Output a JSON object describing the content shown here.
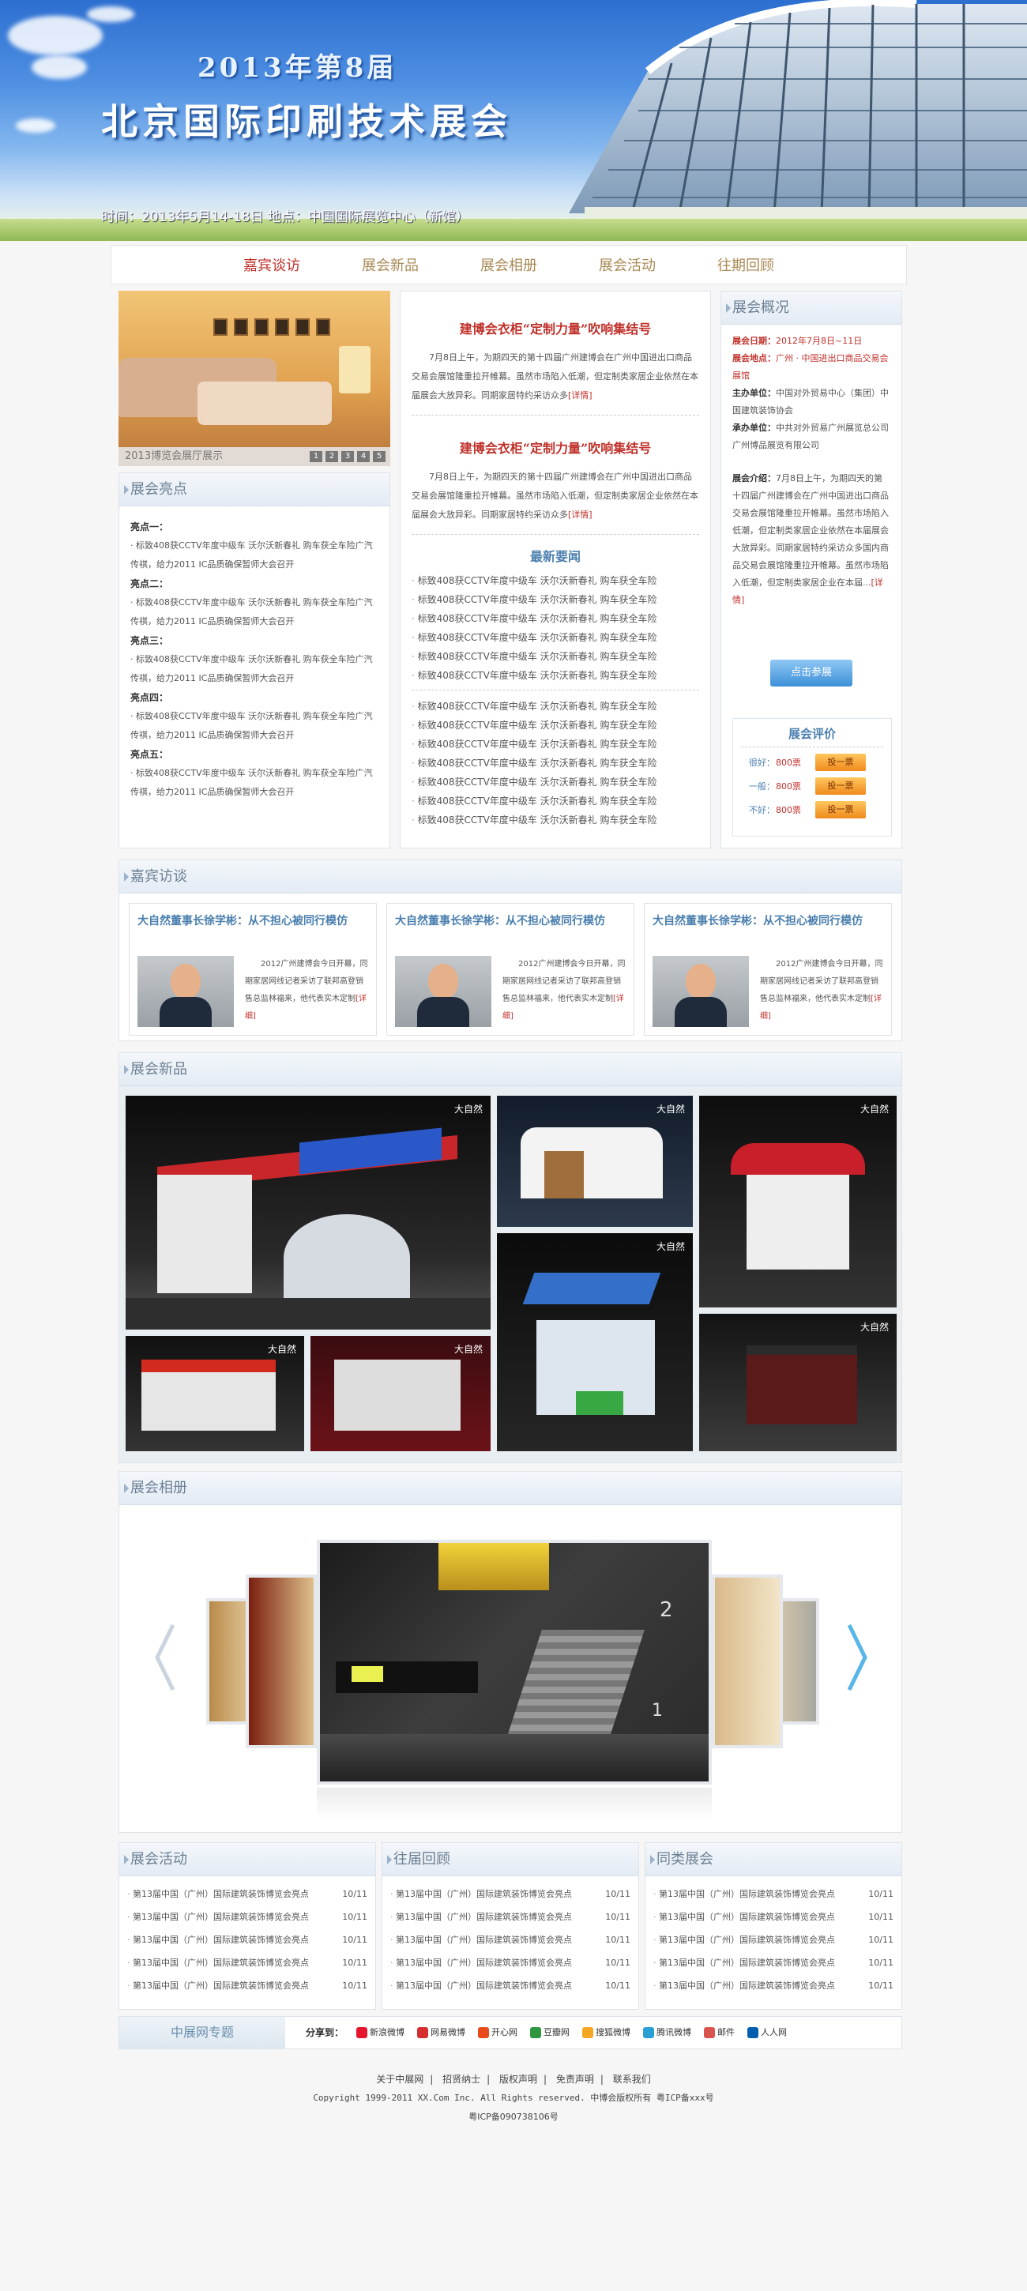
{
  "banner": {
    "subtitle": "2013年第8届",
    "title": "北京国际印刷技术展会",
    "info": "时间：2013年5月14-18日  地点：中国国际展览中心（新馆）"
  },
  "nav": [
    "嘉宾谈访",
    "展会新品",
    "展会相册",
    "展会活动",
    "往期回顾"
  ],
  "slider": {
    "caption": "2013博览会展厅展示",
    "pages": [
      "1",
      "2",
      "3",
      "4",
      "5"
    ]
  },
  "highlights": {
    "title": "展会亮点",
    "items": [
      {
        "label": "亮点一：",
        "text": "· 标致408获CCTV年度中级车 沃尔沃新春礼 购车获全车险广汽传祺，给力2011 IC品质确保暂师大会召开"
      },
      {
        "label": "亮点二：",
        "text": "· 标致408获CCTV年度中级车 沃尔沃新春礼 购车获全车险广汽传祺，给力2011 IC品质确保暂师大会召开"
      },
      {
        "label": "亮点三：",
        "text": "· 标致408获CCTV年度中级车 沃尔沃新春礼 购车获全车险广汽传祺，给力2011 IC品质确保暂师大会召开"
      },
      {
        "label": "亮点四：",
        "text": "· 标致408获CCTV年度中级车 沃尔沃新春礼 购车获全车险广汽传祺，给力2011 IC品质确保暂师大会召开"
      },
      {
        "label": "亮点五：",
        "text": "· 标致408获CCTV年度中级车 沃尔沃新春礼 购车获全车险广汽传祺，给力2011 IC品质确保暂师大会召开"
      }
    ]
  },
  "news": {
    "headline1": "建博会衣柜“定制力量”吹响集结号",
    "para1": "7月8日上午，为期四天的第十四届广州建博会在广州中国进出口商品交易会展馆隆重拉开帷幕。虽然市场陷入低潮，但定制类家居企业依然在本届展会大放异彩。同期家居特约采访众多",
    "more": "[详情]",
    "headline2": "建博会衣柜“定制力量”吹响集结号",
    "para2": "7月8日上午，为期四天的第十四届广州建博会在广州中国进出口商品交易会展馆隆重拉开帷幕。虽然市场陷入低潮，但定制类家居企业依然在本届展会大放异彩。同期家居特约采访众多",
    "latest_title": "最新要闻",
    "list1": [
      "标致408获CCTV年度中级车 沃尔沃新春礼 购车获全车险",
      "标致408获CCTV年度中级车 沃尔沃新春礼 购车获全车险",
      "标致408获CCTV年度中级车 沃尔沃新春礼 购车获全车险",
      "标致408获CCTV年度中级车 沃尔沃新春礼 购车获全车险",
      "标致408获CCTV年度中级车 沃尔沃新春礼 购车获全车险",
      "标致408获CCTV年度中级车 沃尔沃新春礼 购车获全车险"
    ],
    "list2": [
      "标致408获CCTV年度中级车 沃尔沃新春礼 购车获全车险",
      "标致408获CCTV年度中级车 沃尔沃新春礼 购车获全车险",
      "标致408获CCTV年度中级车 沃尔沃新春礼 购车获全车险",
      "标致408获CCTV年度中级车 沃尔沃新春礼 购车获全车险",
      "标致408获CCTV年度中级车 沃尔沃新春礼 购车获全车险",
      "标致408获CCTV年度中级车 沃尔沃新春礼 购车获全车险",
      "标致408获CCTV年度中级车 沃尔沃新春礼 购车获全车险"
    ]
  },
  "overview": {
    "title": "展会概况",
    "date_label": "展会日期：",
    "date": "2012年7月8日~11日",
    "venue_label": "展会地点：",
    "venue": "广州 · 中国进出口商品交易会展馆",
    "host_label": "主办单位：",
    "host": "中国对外贸易中心（集团）中国建筑装饰协会",
    "organizer_label": "承办单位：",
    "organizer": "中共对外贸易广州展览总公司广州博品展览有限公司",
    "intro_label": "展会介绍：",
    "intro": "7月8日上午，为期四天的第十四届广州建博会在广州中国进出口商品交易会展馆隆重拉开帷幕。虽然市场陷入低潮，但定制类家居企业依然在本届展会大放异彩。同期家居特约采访众多国内商品交易会展馆隆重拉开帷幕。虽然市场陷入低潮，但定制类家居企业在本届...",
    "more": "[详情]",
    "visit_button": "点击参展",
    "rating": {
      "title": "展会评价",
      "rows": [
        {
          "label": "很好：",
          "count": "800票",
          "button": "投一票"
        },
        {
          "label": "一般：",
          "count": "800票",
          "button": "投一票"
        },
        {
          "label": "不好：",
          "count": "800票",
          "button": "投一票"
        }
      ]
    }
  },
  "guests": {
    "title": "嘉宾访谈",
    "cards": [
      {
        "heading": "大自然董事长徐学彬：从不担心被同行模仿",
        "text": "2012广州建博会今日开幕，同期家居网线记者采访了联邦高登销售总监林福来，他代表实木定制",
        "more": "[详细]"
      },
      {
        "heading": "大自然董事长徐学彬：从不担心被同行模仿",
        "text": "2012广州建博会今日开幕，同期家居网线记者采访了联邦高登销售总监林福来，他代表实木定制",
        "more": "[详细]"
      },
      {
        "heading": "大自然董事长徐学彬：从不担心被同行模仿",
        "text": "2012广州建博会今日开幕，同期家居网线记者采访了联邦高登销售总监林福来，他代表实木定制",
        "more": "[详细]"
      }
    ]
  },
  "products": {
    "title": "展会新品",
    "tag": "大自然"
  },
  "gallery": {
    "title": "展会相册"
  },
  "activities": {
    "title": "展会活动",
    "items": [
      {
        "text": "第13届中国（广州）国际建筑装饰博览会亮点",
        "date": "10/11"
      },
      {
        "text": "第13届中国（广州）国际建筑装饰博览会亮点",
        "date": "10/11"
      },
      {
        "text": "第13届中国（广州）国际建筑装饰博览会亮点",
        "date": "10/11"
      },
      {
        "text": "第13届中国（广州）国际建筑装饰博览会亮点",
        "date": "10/11"
      },
      {
        "text": "第13届中国（广州）国际建筑装饰博览会亮点",
        "date": "10/11"
      }
    ]
  },
  "review": {
    "title": "往届回顾",
    "items": [
      {
        "text": "第13届中国（广州）国际建筑装饰博览会亮点",
        "date": "10/11"
      },
      {
        "text": "第13届中国（广州）国际建筑装饰博览会亮点",
        "date": "10/11"
      },
      {
        "text": "第13届中国（广州）国际建筑装饰博览会亮点",
        "date": "10/11"
      },
      {
        "text": "第13届中国（广州）国际建筑装饰博览会亮点",
        "date": "10/11"
      },
      {
        "text": "第13届中国（广州）国际建筑装饰博览会亮点",
        "date": "10/11"
      }
    ]
  },
  "similar": {
    "title": "同类展会",
    "items": [
      {
        "text": "第13届中国（广州）国际建筑装饰博览会亮点",
        "date": "10/11"
      },
      {
        "text": "第13届中国（广州）国际建筑装饰博览会亮点",
        "date": "10/11"
      },
      {
        "text": "第13届中国（广州）国际建筑装饰博览会亮点",
        "date": "10/11"
      },
      {
        "text": "第13届中国（广州）国际建筑装饰博览会亮点",
        "date": "10/11"
      },
      {
        "text": "第13届中国（广州）国际建筑装饰博览会亮点",
        "date": "10/11"
      }
    ]
  },
  "share": {
    "tag": "中展网专题",
    "label": "分享到：",
    "items": [
      {
        "name": "新浪微博",
        "color": "#e6162d"
      },
      {
        "name": "网易微博",
        "color": "#d42e2e"
      },
      {
        "name": "开心网",
        "color": "#e94a1b"
      },
      {
        "name": "豆瓣网",
        "color": "#2e963d"
      },
      {
        "name": "搜狐微博",
        "color": "#f5a623"
      },
      {
        "name": "腾讯微博",
        "color": "#2a9fd6"
      },
      {
        "name": "邮件",
        "color": "#d9534f"
      },
      {
        "name": "人人网",
        "color": "#005eac"
      }
    ]
  },
  "footer": {
    "links": [
      "关于中展网",
      "招贤纳士",
      "版权声明",
      "免责声明",
      "联系我们"
    ],
    "copyright": "Copyright 1999-2011 XX.Com Inc. All Rights reserved. 中博会版权所有 粤ICP备xxx号",
    "icp": "粤ICP备090738106号"
  }
}
